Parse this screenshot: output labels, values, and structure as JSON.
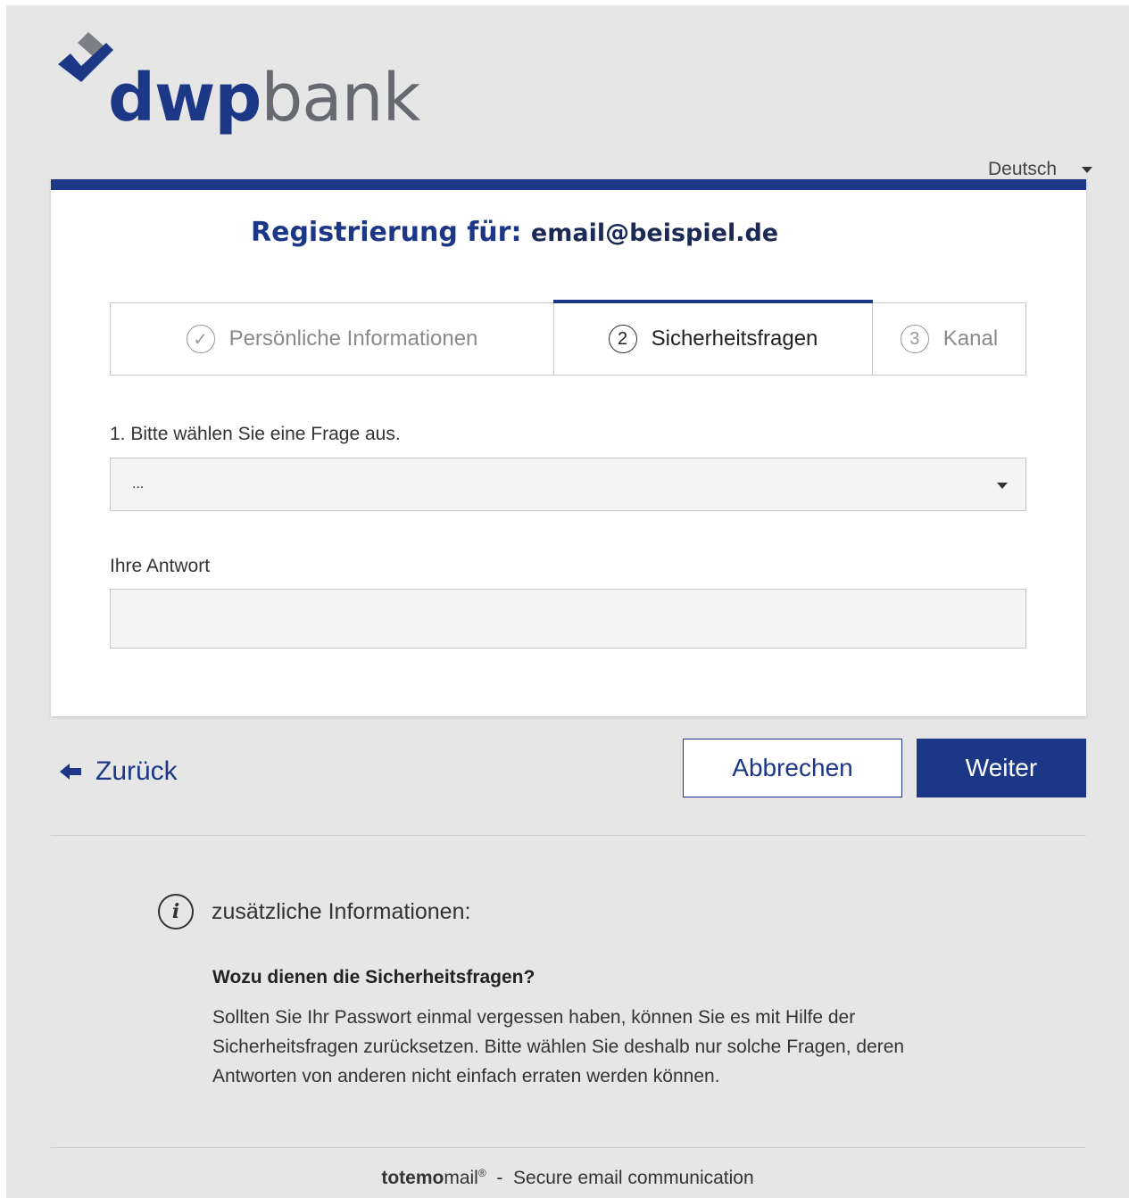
{
  "brand": {
    "name_bold": "dwp",
    "name_light": "bank",
    "primary_color": "#1d3787",
    "secondary_color": "#666a70"
  },
  "language": {
    "selected": "Deutsch"
  },
  "registration": {
    "title_prefix": "Registrierung für:",
    "email": "email@beispiel.de"
  },
  "steps": [
    {
      "number": "✓",
      "label": "Persönliche Informationen",
      "state": "done"
    },
    {
      "number": "2",
      "label": "Sicherheitsfragen",
      "state": "active"
    },
    {
      "number": "3",
      "label": "Kanal",
      "state": "pending"
    }
  ],
  "form": {
    "question_label": "1. Bitte wählen Sie eine Frage aus.",
    "question_value": "...",
    "answer_label": "Ihre Antwort",
    "answer_value": ""
  },
  "actions": {
    "back_label": "Zurück",
    "cancel_label": "Abbrechen",
    "next_label": "Weiter"
  },
  "info": {
    "heading": "zusätzliche Informationen:",
    "question": "Wozu dienen die Sicherheitsfragen?",
    "body": "Sollten Sie Ihr Passwort einmal vergessen haben, können Sie es mit Hilfe der Sicherheitsfragen zurücksetzen. Bitte wählen Sie deshalb nur solche Fragen, deren Antworten von anderen nicht einfach erraten werden können."
  },
  "footer": {
    "brand_bold": "totemo",
    "brand_light": "mail",
    "reg_mark": "®",
    "separator": "-",
    "tagline": "Secure email communication"
  }
}
